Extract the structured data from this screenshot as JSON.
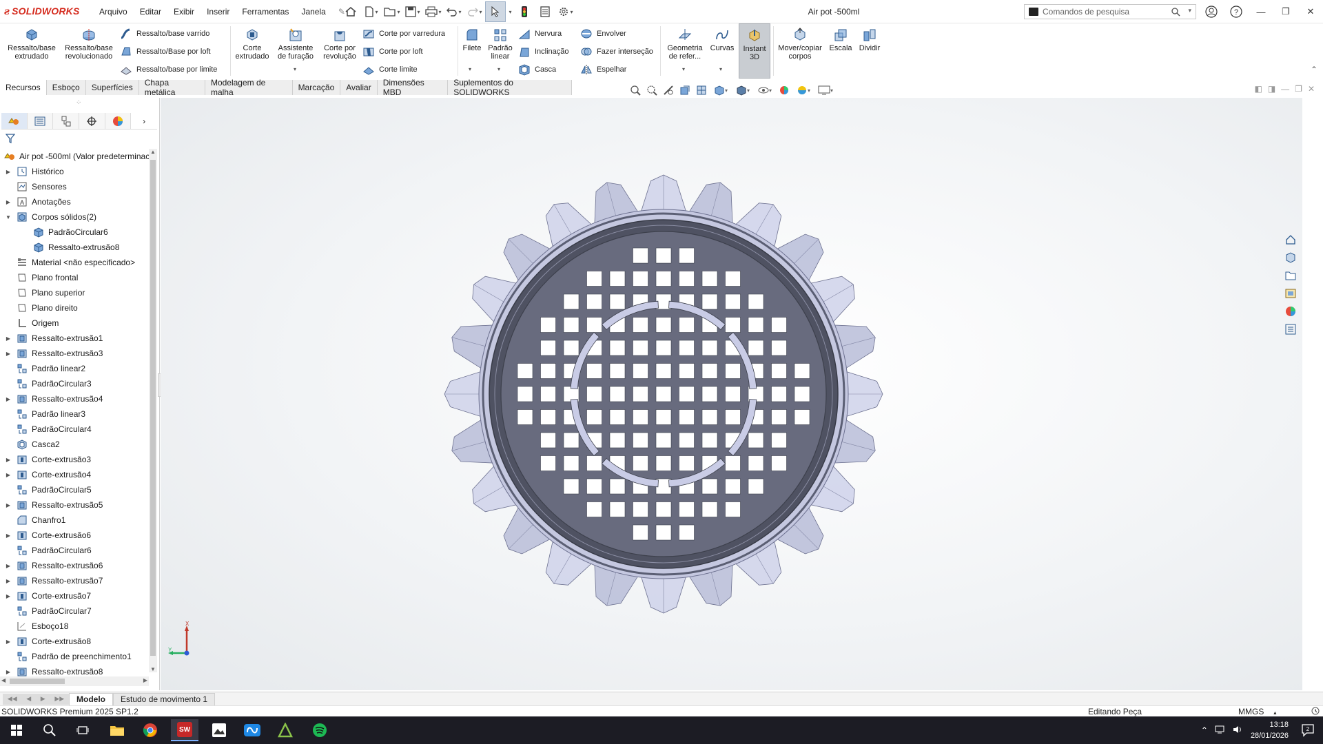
{
  "app": {
    "name": "SOLIDWORKS",
    "document_title": "Air pot -500ml",
    "brand_color": "#d52b1e"
  },
  "menu": [
    "Arquivo",
    "Editar",
    "Exibir",
    "Inserir",
    "Ferramentas",
    "Janela"
  ],
  "search": {
    "placeholder": "Comandos de pesquisa"
  },
  "ribbon": {
    "big": [
      {
        "line1": "Ressalto/base",
        "line2": "extrudado"
      },
      {
        "line1": "Ressalto/base",
        "line2": "revolucionado"
      },
      {
        "line1": "Corte",
        "line2": "extrudado"
      },
      {
        "line1": "Assistente",
        "line2": "de furação"
      },
      {
        "line1": "Corte por",
        "line2": "revolução"
      },
      {
        "line1": "Filete",
        "line2": ""
      },
      {
        "line1": "Padrão",
        "line2": "linear"
      },
      {
        "line1": "Geometria",
        "line2": "de refer..."
      },
      {
        "line1": "Curvas",
        "line2": ""
      },
      {
        "line1": "Instant",
        "line2": "3D"
      },
      {
        "line1": "Mover/copiar",
        "line2": "corpos"
      },
      {
        "line1": "Escala",
        "line2": ""
      },
      {
        "line1": "Dividir",
        "line2": ""
      }
    ],
    "small": [
      "Ressalto/base varrido",
      "Ressalto/Base por loft",
      "Ressalto/base por limite",
      "Corte por varredura",
      "Corte por loft",
      "Corte limite",
      "Nervura",
      "Inclinação",
      "Casca",
      "Envolver",
      "Fazer interseção",
      "Espelhar"
    ]
  },
  "command_tabs": [
    "Recursos",
    "Esboço",
    "Superfícies",
    "Chapa metálica",
    "Modelagem de malha",
    "Marcação",
    "Avaliar",
    "Dimensões MBD",
    "Suplementos do SOLIDWORKS"
  ],
  "tree": {
    "root": "Air pot -500ml  (Valor predeterminac",
    "items": [
      {
        "label": "Histórico",
        "exp": "▶",
        "icon": "history"
      },
      {
        "label": "Sensores",
        "exp": "",
        "icon": "sensor"
      },
      {
        "label": "Anotações",
        "exp": "▶",
        "icon": "annotation"
      },
      {
        "label": "Corpos sólidos(2)",
        "exp": "▼",
        "icon": "solid"
      },
      {
        "label": "PadrãoCircular6",
        "exp": "",
        "icon": "body",
        "indent": 1
      },
      {
        "label": "Ressalto-extrusão8",
        "exp": "",
        "icon": "body",
        "indent": 1
      },
      {
        "label": "Material <não especificado>",
        "exp": "",
        "icon": "material"
      },
      {
        "label": "Plano frontal",
        "exp": "",
        "icon": "plane"
      },
      {
        "label": "Plano superior",
        "exp": "",
        "icon": "plane"
      },
      {
        "label": "Plano direito",
        "exp": "",
        "icon": "plane"
      },
      {
        "label": "Origem",
        "exp": "",
        "icon": "origin"
      },
      {
        "label": "Ressalto-extrusão1",
        "exp": "▶",
        "icon": "boss"
      },
      {
        "label": "Ressalto-extrusão3",
        "exp": "▶",
        "icon": "boss"
      },
      {
        "label": "Padrão linear2",
        "exp": "",
        "icon": "pattern"
      },
      {
        "label": "PadrãoCircular3",
        "exp": "",
        "icon": "pattern"
      },
      {
        "label": "Ressalto-extrusão4",
        "exp": "▶",
        "icon": "boss"
      },
      {
        "label": "Padrão linear3",
        "exp": "",
        "icon": "pattern"
      },
      {
        "label": "PadrãoCircular4",
        "exp": "",
        "icon": "pattern"
      },
      {
        "label": "Casca2",
        "exp": "",
        "icon": "shell"
      },
      {
        "label": "Corte-extrusão3",
        "exp": "▶",
        "icon": "cut"
      },
      {
        "label": "Corte-extrusão4",
        "exp": "▶",
        "icon": "cut"
      },
      {
        "label": "PadrãoCircular5",
        "exp": "",
        "icon": "pattern"
      },
      {
        "label": "Ressalto-extrusão5",
        "exp": "▶",
        "icon": "boss"
      },
      {
        "label": "Chanfro1",
        "exp": "",
        "icon": "chamfer"
      },
      {
        "label": "Corte-extrusão6",
        "exp": "▶",
        "icon": "cut"
      },
      {
        "label": "PadrãoCircular6",
        "exp": "",
        "icon": "pattern"
      },
      {
        "label": "Ressalto-extrusão6",
        "exp": "▶",
        "icon": "boss"
      },
      {
        "label": "Ressalto-extrusão7",
        "exp": "▶",
        "icon": "boss"
      },
      {
        "label": "Corte-extrusão7",
        "exp": "▶",
        "icon": "cut"
      },
      {
        "label": "PadrãoCircular7",
        "exp": "",
        "icon": "pattern"
      },
      {
        "label": "Esboço18",
        "exp": "",
        "icon": "sketch"
      },
      {
        "label": "Corte-extrusão8",
        "exp": "▶",
        "icon": "cut"
      },
      {
        "label": "Padrão de preenchimento1",
        "exp": "",
        "icon": "pattern"
      },
      {
        "label": "Ressalto-extrusão8",
        "exp": "▶",
        "icon": "boss"
      }
    ]
  },
  "triad": {
    "x": "X",
    "y": "Y"
  },
  "bottom_tabs": [
    "Modelo",
    "Estudo de movimento 1"
  ],
  "status": {
    "product": "SOLIDWORKS Premium 2025 SP1.2",
    "mode": "Editando Peça",
    "units": "MMGS"
  },
  "taskbar": {
    "time": "13:18",
    "date": "28/01/2026"
  }
}
